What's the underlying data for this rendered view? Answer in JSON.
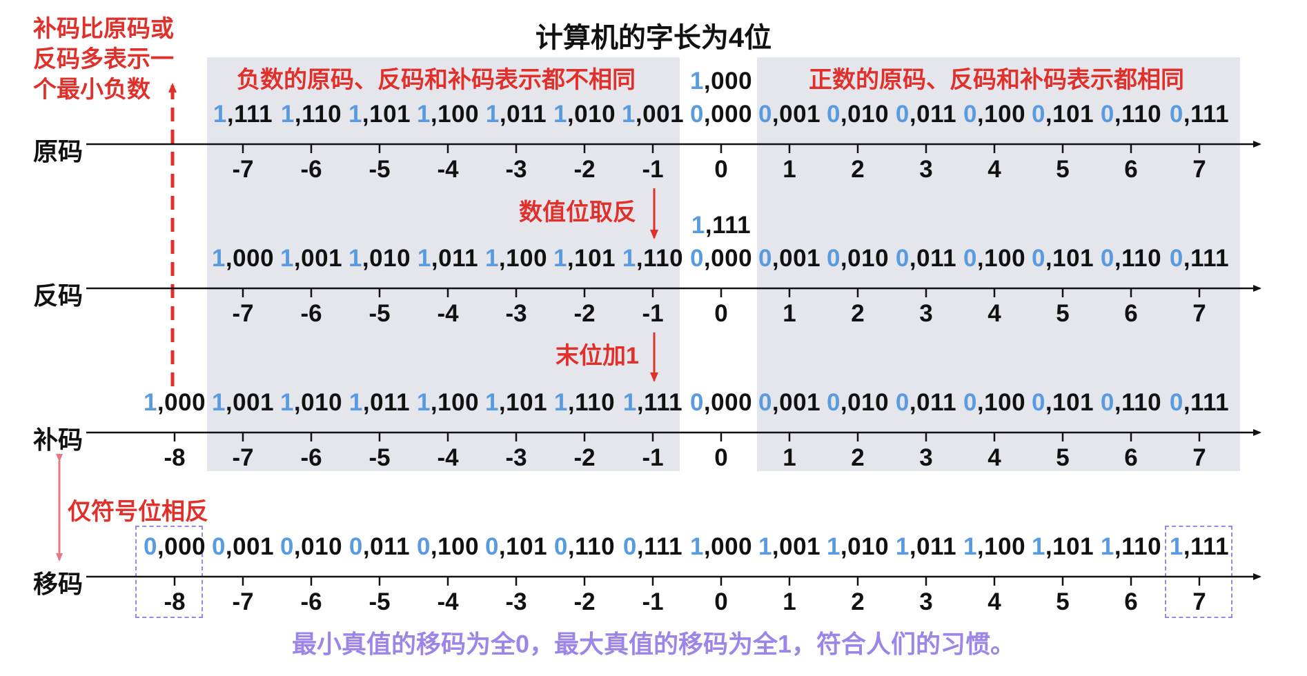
{
  "title": "计算机的字长为4位",
  "side_note": [
    "补码比原码或",
    "反码多表示一",
    "个最小负数"
  ],
  "negative_note": "负数的原码、反码和补码表示都不相同",
  "positive_note": "正数的原码、反码和补码表示都相同",
  "step1_label": "数值位取反",
  "step2_label": "末位加1",
  "sign_note": "仅符号位相反",
  "bottom_note": "最小真值的移码为全0，最大真值的移码为全1，符合人们的习惯。",
  "colors": {
    "red": "#e0302b",
    "blue": "#5a9be0",
    "purple": "#9b85e6",
    "shade": "#e5e6eb"
  },
  "rows": [
    {
      "label": "原码",
      "extra_code": {
        "sign": "1",
        "rest": ",000",
        "value": "0"
      },
      "codes": [
        {
          "sign": "1",
          "rest": ",111",
          "value": "-7"
        },
        {
          "sign": "1",
          "rest": ",110",
          "value": "-6"
        },
        {
          "sign": "1",
          "rest": ",101",
          "value": "-5"
        },
        {
          "sign": "1",
          "rest": ",100",
          "value": "-4"
        },
        {
          "sign": "1",
          "rest": ",011",
          "value": "-3"
        },
        {
          "sign": "1",
          "rest": ",010",
          "value": "-2"
        },
        {
          "sign": "1",
          "rest": ",001",
          "value": "-1"
        },
        {
          "sign": "0",
          "rest": ",000",
          "value": "0"
        },
        {
          "sign": "0",
          "rest": ",001",
          "value": "1"
        },
        {
          "sign": "0",
          "rest": ",010",
          "value": "2"
        },
        {
          "sign": "0",
          "rest": ",011",
          "value": "3"
        },
        {
          "sign": "0",
          "rest": ",100",
          "value": "4"
        },
        {
          "sign": "0",
          "rest": ",101",
          "value": "5"
        },
        {
          "sign": "0",
          "rest": ",110",
          "value": "6"
        },
        {
          "sign": "0",
          "rest": ",111",
          "value": "7"
        }
      ]
    },
    {
      "label": "反码",
      "extra_code": {
        "sign": "1",
        "rest": ",111",
        "value": "0"
      },
      "codes": [
        {
          "sign": "1",
          "rest": ",000",
          "value": "-7"
        },
        {
          "sign": "1",
          "rest": ",001",
          "value": "-6"
        },
        {
          "sign": "1",
          "rest": ",010",
          "value": "-5"
        },
        {
          "sign": "1",
          "rest": ",011",
          "value": "-4"
        },
        {
          "sign": "1",
          "rest": ",100",
          "value": "-3"
        },
        {
          "sign": "1",
          "rest": ",101",
          "value": "-2"
        },
        {
          "sign": "1",
          "rest": ",110",
          "value": "-1"
        },
        {
          "sign": "0",
          "rest": ",000",
          "value": "0"
        },
        {
          "sign": "0",
          "rest": ",001",
          "value": "1"
        },
        {
          "sign": "0",
          "rest": ",010",
          "value": "2"
        },
        {
          "sign": "0",
          "rest": ",011",
          "value": "3"
        },
        {
          "sign": "0",
          "rest": ",100",
          "value": "4"
        },
        {
          "sign": "0",
          "rest": ",101",
          "value": "5"
        },
        {
          "sign": "0",
          "rest": ",110",
          "value": "6"
        },
        {
          "sign": "0",
          "rest": ",111",
          "value": "7"
        }
      ]
    },
    {
      "label": "补码",
      "codes": [
        {
          "sign": "1",
          "rest": ",000",
          "value": "-8"
        },
        {
          "sign": "1",
          "rest": ",001",
          "value": "-7"
        },
        {
          "sign": "1",
          "rest": ",010",
          "value": "-6"
        },
        {
          "sign": "1",
          "rest": ",011",
          "value": "-5"
        },
        {
          "sign": "1",
          "rest": ",100",
          "value": "-4"
        },
        {
          "sign": "1",
          "rest": ",101",
          "value": "-3"
        },
        {
          "sign": "1",
          "rest": ",110",
          "value": "-2"
        },
        {
          "sign": "1",
          "rest": ",111",
          "value": "-1"
        },
        {
          "sign": "0",
          "rest": ",000",
          "value": "0"
        },
        {
          "sign": "0",
          "rest": ",001",
          "value": "1"
        },
        {
          "sign": "0",
          "rest": ",010",
          "value": "2"
        },
        {
          "sign": "0",
          "rest": ",011",
          "value": "3"
        },
        {
          "sign": "0",
          "rest": ",100",
          "value": "4"
        },
        {
          "sign": "0",
          "rest": ",101",
          "value": "5"
        },
        {
          "sign": "0",
          "rest": ",110",
          "value": "6"
        },
        {
          "sign": "0",
          "rest": ",111",
          "value": "7"
        }
      ]
    },
    {
      "label": "移码",
      "codes": [
        {
          "sign": "0",
          "rest": ",000",
          "value": "-8"
        },
        {
          "sign": "0",
          "rest": ",001",
          "value": "-7"
        },
        {
          "sign": "0",
          "rest": ",010",
          "value": "-6"
        },
        {
          "sign": "0",
          "rest": ",011",
          "value": "-5"
        },
        {
          "sign": "0",
          "rest": ",100",
          "value": "-4"
        },
        {
          "sign": "0",
          "rest": ",101",
          "value": "-3"
        },
        {
          "sign": "0",
          "rest": ",110",
          "value": "-2"
        },
        {
          "sign": "0",
          "rest": ",111",
          "value": "-1"
        },
        {
          "sign": "1",
          "rest": ",000",
          "value": "0"
        },
        {
          "sign": "1",
          "rest": ",001",
          "value": "1"
        },
        {
          "sign": "1",
          "rest": ",010",
          "value": "2"
        },
        {
          "sign": "1",
          "rest": ",011",
          "value": "3"
        },
        {
          "sign": "1",
          "rest": ",100",
          "value": "4"
        },
        {
          "sign": "1",
          "rest": ",101",
          "value": "5"
        },
        {
          "sign": "1",
          "rest": ",110",
          "value": "6"
        },
        {
          "sign": "1",
          "rest": ",111",
          "value": "7"
        }
      ]
    }
  ]
}
